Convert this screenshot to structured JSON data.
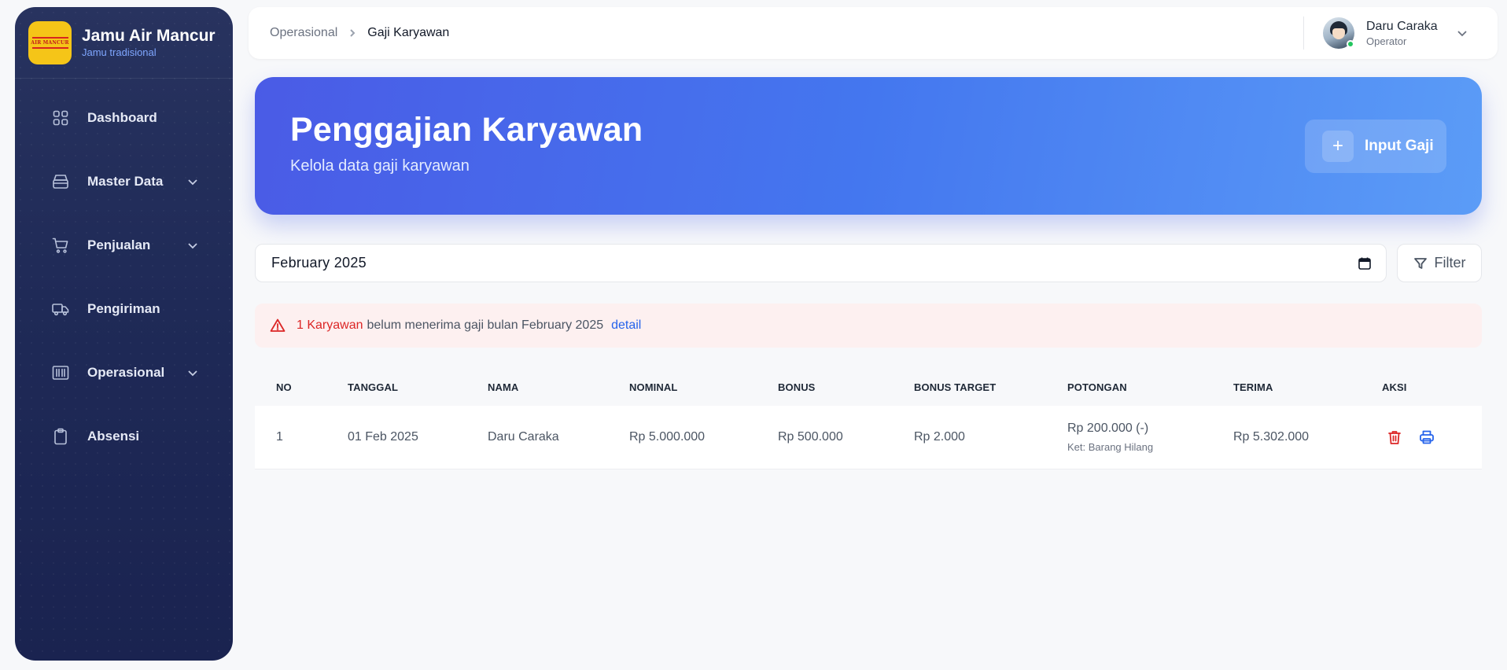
{
  "brand": {
    "title": "Jamu Air Mancur",
    "subtitle": "Jamu tradisional",
    "logo_text": "AIR MANCUR",
    "logo_color": "#f5c518"
  },
  "sidebar": {
    "items": [
      {
        "label": "Dashboard",
        "icon": "grid-icon",
        "has_submenu": false
      },
      {
        "label": "Master Data",
        "icon": "archive-box-icon",
        "has_submenu": true
      },
      {
        "label": "Penjualan",
        "icon": "shopping-cart-icon",
        "has_submenu": true
      },
      {
        "label": "Pengiriman",
        "icon": "truck-icon",
        "has_submenu": false
      },
      {
        "label": "Operasional",
        "icon": "barcode-icon",
        "has_submenu": true
      },
      {
        "label": "Absensi",
        "icon": "clipboard-icon",
        "has_submenu": false
      }
    ]
  },
  "breadcrumb": {
    "parent": "Operasional",
    "current": "Gaji Karyawan"
  },
  "user": {
    "name": "Daru Caraka",
    "role": "Operator",
    "status": "online"
  },
  "hero": {
    "title": "Penggajian Karyawan",
    "subtitle": "Kelola data gaji karyawan",
    "button_label": "Input Gaji",
    "button_icon": "plus-icon"
  },
  "filter": {
    "month_value": "February 2025",
    "button_label": "Filter"
  },
  "alert": {
    "count_text": "1 Karyawan",
    "message": "belum menerima gaji bulan February 2025",
    "link_text": "detail"
  },
  "table": {
    "headers": [
      "NO",
      "TANGGAL",
      "NAMA",
      "NOMINAL",
      "BONUS",
      "BONUS TARGET",
      "POTONGAN",
      "TERIMA",
      "AKSI"
    ],
    "rows": [
      {
        "no": "1",
        "tanggal": "01 Feb 2025",
        "nama": "Daru Caraka",
        "nominal": "Rp 5.000.000",
        "bonus": "Rp 500.000",
        "bonus_target": "Rp 2.000",
        "potongan": "Rp 200.000 (-)",
        "potongan_note": "Ket: Barang Hilang",
        "terima": "Rp 5.302.000"
      }
    ]
  },
  "colors": {
    "sidebar_bg": "#1f2a57",
    "hero_start": "#4a5be6",
    "hero_end": "#5b9cf7",
    "alert_bg": "#fdf0f0",
    "danger": "#dc2626",
    "link": "#2563eb"
  }
}
